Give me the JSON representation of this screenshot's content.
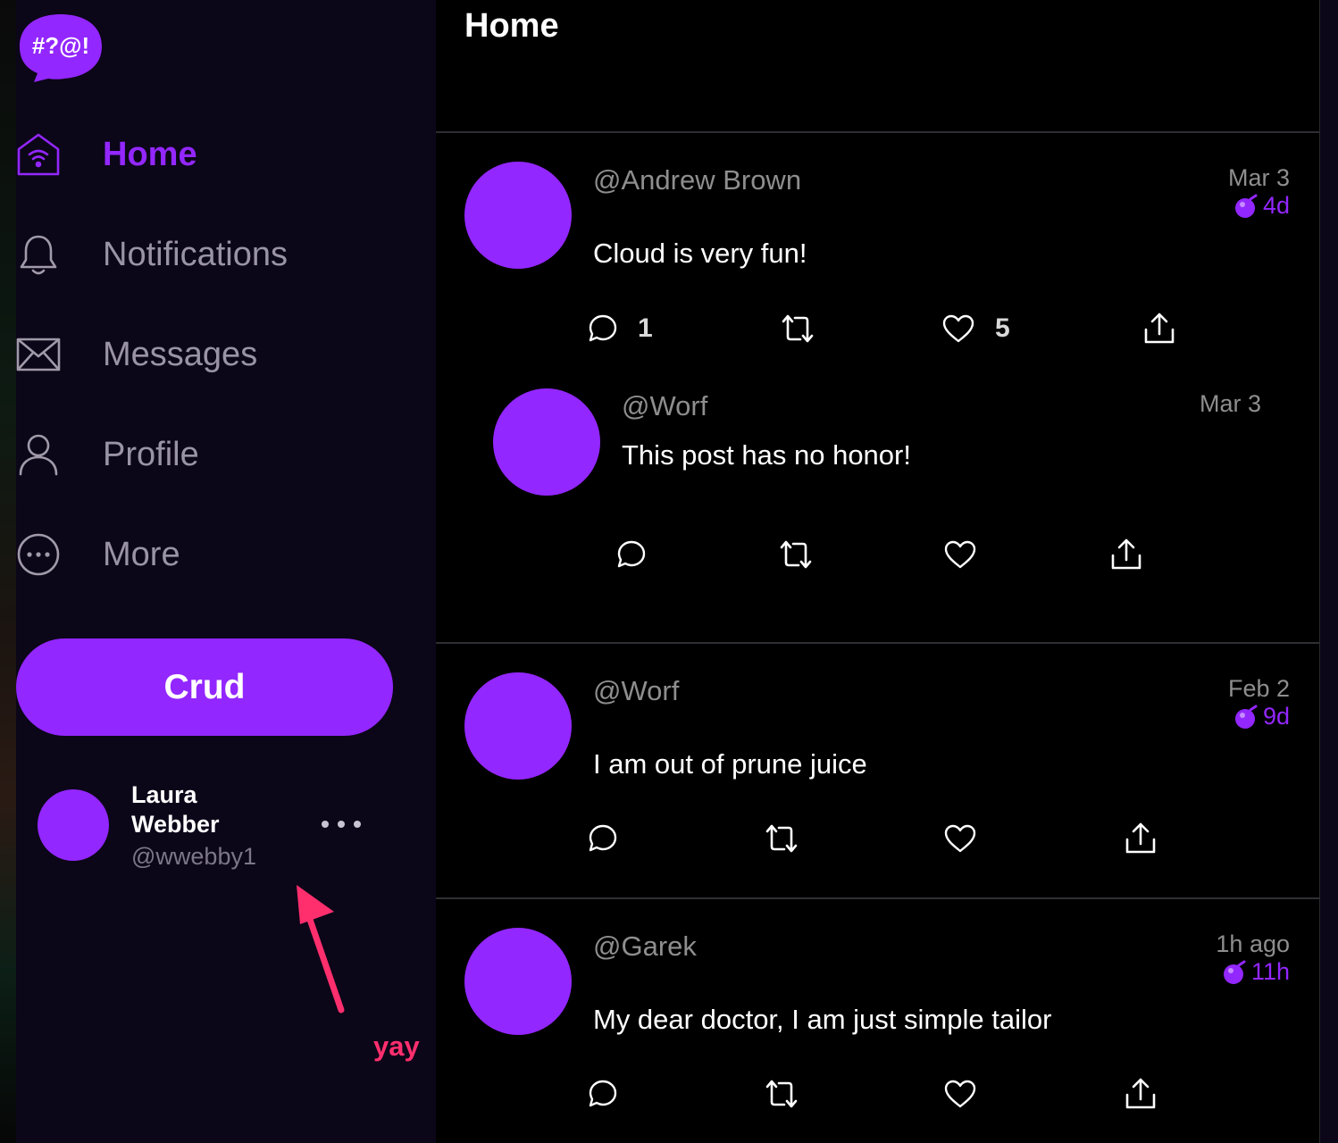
{
  "app": {
    "logo_text": "#?@!",
    "brand_color": "#9327ff",
    "background": "#000000",
    "sidebar_background": "#0c0619"
  },
  "sidebar": {
    "items": [
      {
        "label": "Home",
        "icon": "home-icon",
        "active": true
      },
      {
        "label": "Notifications",
        "icon": "bell-icon",
        "active": false
      },
      {
        "label": "Messages",
        "icon": "envelope-icon",
        "active": false
      },
      {
        "label": "Profile",
        "icon": "person-icon",
        "active": false
      },
      {
        "label": "More",
        "icon": "more-circle-icon",
        "active": false
      }
    ],
    "compose_label": "Crud",
    "user": {
      "name": "Laura Webber",
      "handle": "@wwebby1"
    }
  },
  "annotation": {
    "text": "yay",
    "color": "#ff2f6e"
  },
  "main": {
    "title": "Home",
    "posts": [
      {
        "handle": "@Andrew Brown",
        "text": "Cloud is very fun!",
        "date": "Mar 3",
        "ttl": "4d",
        "replies": "1",
        "likes": "5",
        "reply": {
          "handle": "@Worf",
          "text": "This post has no honor!",
          "date": "Mar 3"
        }
      },
      {
        "handle": "@Worf",
        "text": "I am out of prune juice",
        "date": "Feb 2",
        "ttl": "9d"
      },
      {
        "handle": "@Garek",
        "text": "My dear doctor, I am just simple tailor",
        "date": "1h ago",
        "ttl": "11h"
      }
    ]
  }
}
